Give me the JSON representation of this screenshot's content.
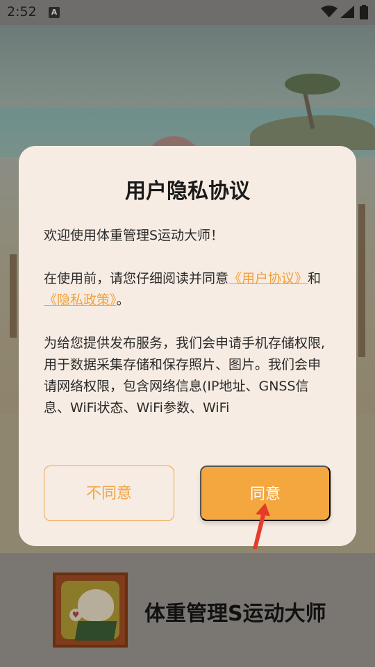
{
  "status_bar": {
    "time": "2:52",
    "notification_icon": "a-badge-icon"
  },
  "dialog": {
    "title": "用户隐私协议",
    "welcome": "欢迎使用体重管理S运动大师！",
    "consent_prefix": "在使用前，请您仔细阅读并同意",
    "user_agreement_link": "《用户协议》",
    "consent_and": "和",
    "privacy_policy_link": "《隐私政策》",
    "consent_suffix": "。",
    "permissions_text": "为给您提供发布服务，我们会申请手机存储权限, 用于数据采集存储和保存照片、图片。我们会申请网络权限，包含网络信息(IP地址、GNSS信息、WiFi状态、WiFi参数、WiFi",
    "disagree_button": "不同意",
    "agree_button": "同意"
  },
  "app": {
    "name": "体重管理S运动大师"
  },
  "colors": {
    "accent": "#f5a73f",
    "link": "#f0a03c",
    "dialog_bg": "#f7ece3"
  }
}
